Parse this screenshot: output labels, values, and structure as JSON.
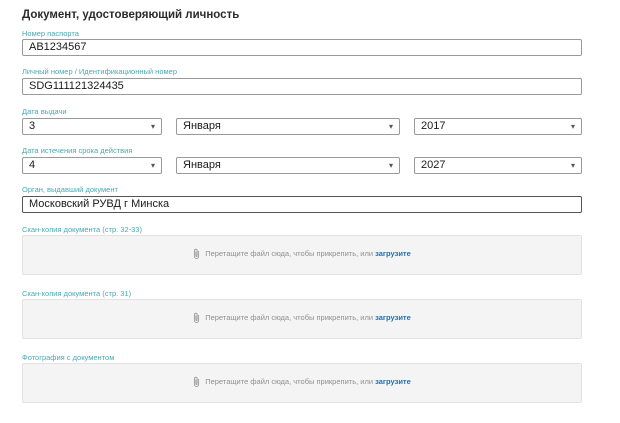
{
  "section_title": "Документ, удостоверяющий личность",
  "passport_number": {
    "label": "Номер паспорта",
    "value": "AB1234567"
  },
  "personal_number": {
    "label": "Личный номер / Идентификационный номер",
    "value": "SDG111121324435"
  },
  "issue_date": {
    "label": "Дата выдачи",
    "day": "3",
    "month": "Января",
    "year": "2017"
  },
  "expiry_date": {
    "label": "Дата истечения срока действия",
    "day": "4",
    "month": "Января",
    "year": "2027"
  },
  "issuing_authority": {
    "label": "Орган, выдавший документ",
    "value": "Московский РУВД г Минска"
  },
  "uploads": [
    {
      "label": "Скан-копия документа (стр. 32-33)",
      "prompt": "Перетащите файл сюда, чтобы прикрепить, или ",
      "link": "загрузите"
    },
    {
      "label": "Скан-копия документа (стр. 31)",
      "prompt": "Перетащите файл сюда, чтобы прикрепить, или ",
      "link": "загрузите"
    },
    {
      "label": "Фотография с документом",
      "prompt": "Перетащите файл сюда, чтобы прикрепить, или ",
      "link": "загрузите"
    }
  ],
  "colors": {
    "label": "#49a9b3",
    "link": "#1f6fb3",
    "dropzone_bg": "#f4f4f4"
  },
  "icons": {
    "select_caret": "caret-down-icon",
    "attach": "paperclip-icon"
  }
}
